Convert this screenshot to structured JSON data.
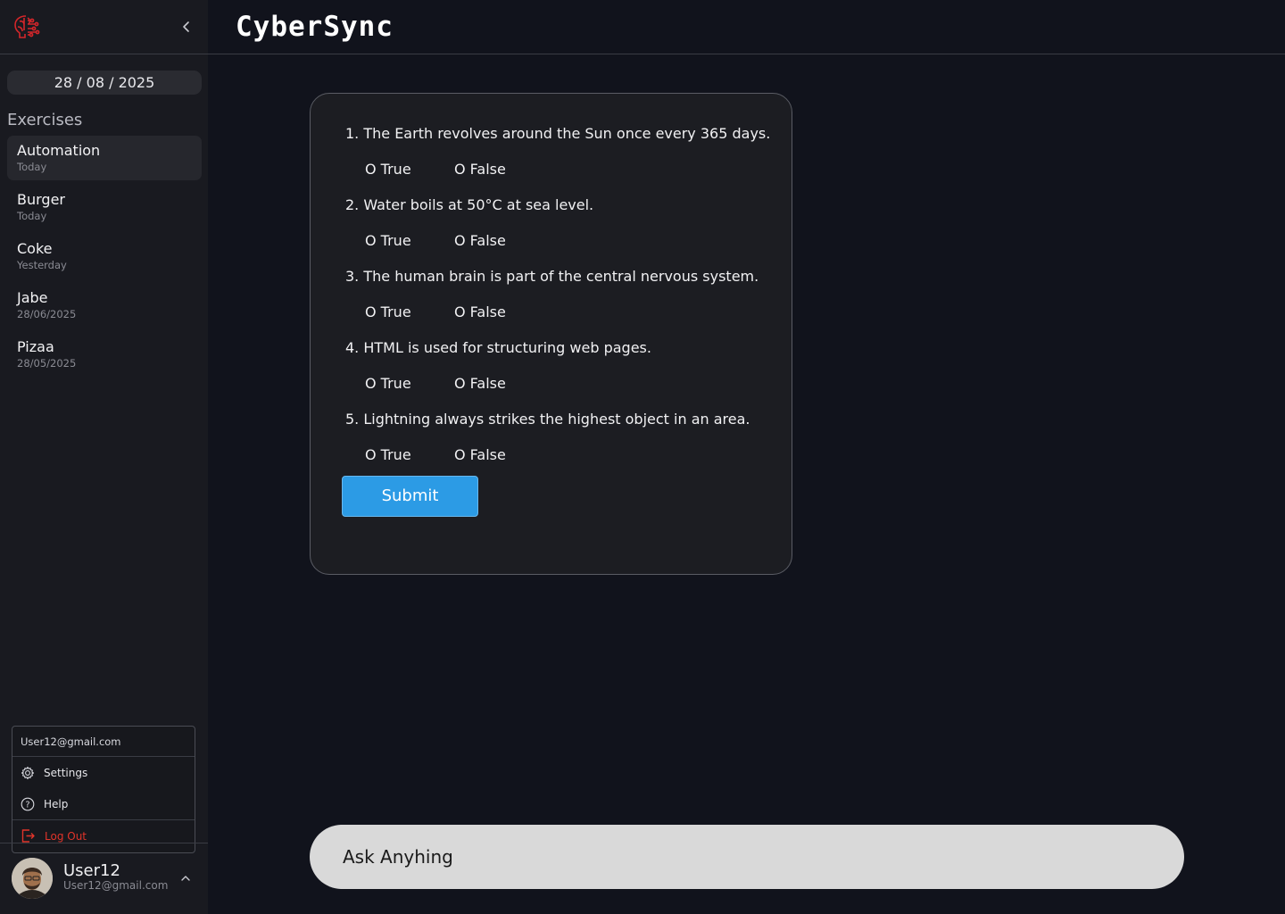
{
  "app": {
    "brand": "CyberSync",
    "accent_color": "#2c9be5",
    "danger_color": "#e1342a"
  },
  "sidebar": {
    "date": "28 / 08 / 2025",
    "section_title": "Exercises",
    "exercises": [
      {
        "title": "Automation",
        "sub": "Today"
      },
      {
        "title": "Burger",
        "sub": "Today"
      },
      {
        "title": "Coke",
        "sub": "Yesterday"
      },
      {
        "title": "Jabe",
        "sub": "28/06/2025"
      },
      {
        "title": "Pizaa",
        "sub": "28/05/2025"
      }
    ]
  },
  "menu": {
    "email": "User12@gmail.com",
    "settings": "Settings",
    "help": "Help",
    "logout": "Log Out"
  },
  "user": {
    "name": "User12",
    "email": "User12@gmail.com"
  },
  "quiz": {
    "questions": [
      {
        "text": "1. The Earth revolves around the Sun once every 365 days.",
        "true_label": "O True",
        "false_label": "O False"
      },
      {
        "text": "2. Water boils at 50°C at sea level.",
        "true_label": "O True",
        "false_label": "O False"
      },
      {
        "text": "3. The human brain is part of the central nervous system.",
        "true_label": "O True",
        "false_label": "O False"
      },
      {
        "text": "4. HTML is used for structuring web pages.",
        "true_label": "O True",
        "false_label": "O False"
      },
      {
        "text": "5. Lightning always strikes the highest object in an area.",
        "true_label": "O True",
        "false_label": "O False"
      }
    ],
    "submit_label": "Submit"
  },
  "ask": {
    "placeholder": "Ask Anyhing"
  }
}
